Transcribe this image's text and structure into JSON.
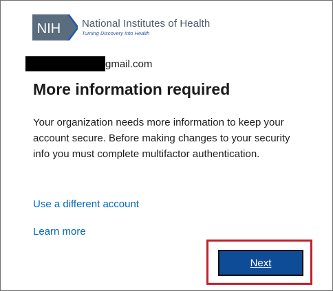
{
  "brand": {
    "short": "NIH",
    "name": "National Institutes of Health",
    "tagline": "Turning Discovery Into Health",
    "colors": {
      "mark_fill": "#5a6d7e",
      "name_text": "#4a5a6a",
      "tagline_text": "#2a5aa0"
    }
  },
  "account": {
    "email_visible_part": "gmail.com"
  },
  "heading": "More information required",
  "description": "Your organization needs more information to keep your account secure. Before making changes to your security info you must complete multifactor authentication.",
  "links": {
    "use_different_account": "Use a different account",
    "learn_more": "Learn more"
  },
  "actions": {
    "next_label": "Next"
  },
  "colors": {
    "link": "#0067b8",
    "primary_button": "#0f4c97",
    "highlight": "#c0202a"
  }
}
